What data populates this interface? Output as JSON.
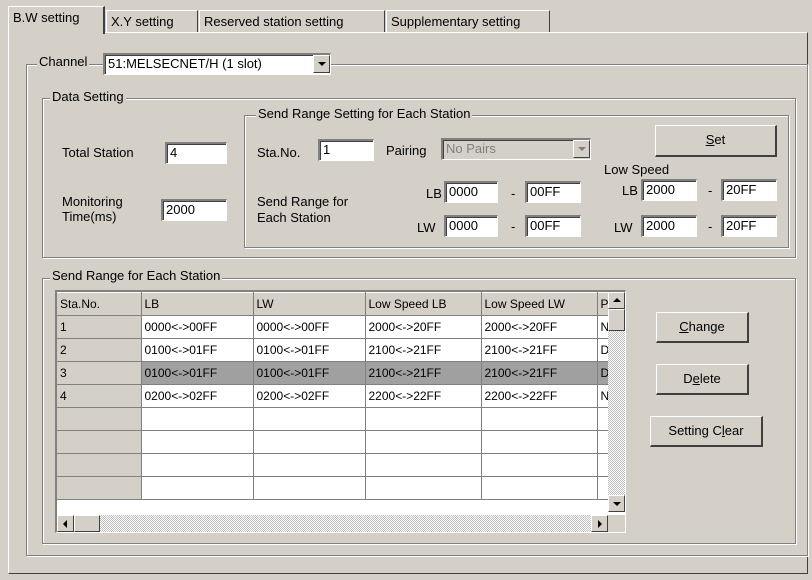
{
  "tabs": [
    {
      "label": "B.W setting",
      "active": true
    },
    {
      "label": "X.Y setting"
    },
    {
      "label": "Reserved station setting"
    },
    {
      "label": "Supplementary setting"
    }
  ],
  "channel": {
    "label": "Channel",
    "value": "51:MELSECNET/H (1 slot)"
  },
  "data_setting": {
    "title": "Data Setting",
    "total_station_label": "Total Station",
    "total_station_value": "4",
    "monitoring_label_line1": "Monitoring",
    "monitoring_label_line2": "Time(ms)",
    "monitoring_value": "2000"
  },
  "send_range_setting": {
    "title": "Send Range Setting for Each Station",
    "sta_no_label": "Sta.No.",
    "sta_no_value": "1",
    "pairing_label": "Pairing",
    "pairing_value": "No Pairs",
    "set_button_prefix": "",
    "set_button_mnemonic": "S",
    "set_button_suffix": "et",
    "low_speed_label": "Low Speed",
    "send_range_label_line1": "Send Range for",
    "send_range_label_line2": "Each Station",
    "lb_label": "LB",
    "lw_label": "LW",
    "dash": "-",
    "lb_start": "0000",
    "lb_end": "00FF",
    "lw_start": "0000",
    "lw_end": "00FF",
    "ls_lb_start": "2000",
    "ls_lb_end": "20FF",
    "ls_lw_start": "2000",
    "ls_lw_end": "20FF"
  },
  "station_table": {
    "title": "Send Range for Each Station",
    "headers": [
      "Sta.No.",
      "LB",
      "LW",
      "Low Speed LB",
      "Low Speed LW",
      "P"
    ],
    "rows": [
      [
        "1",
        "0000<->00FF",
        "0000<->00FF",
        "2000<->20FF",
        "2000<->20FF",
        "N"
      ],
      [
        "2",
        "0100<->01FF",
        "0100<->01FF",
        "2100<->21FF",
        "2100<->21FF",
        "D"
      ],
      [
        "3",
        "0100<->01FF",
        "0100<->01FF",
        "2100<->21FF",
        "2100<->21FF",
        "D"
      ],
      [
        "4",
        "0200<->02FF",
        "0200<->02FF",
        "2200<->22FF",
        "2200<->22FF",
        "N"
      ]
    ],
    "selected_row": 3
  },
  "buttons": {
    "change_prefix": "",
    "change_mnemonic": "C",
    "change_suffix": "hange",
    "delete_prefix": "D",
    "delete_mnemonic": "e",
    "delete_suffix": "lete",
    "clear_prefix": "Setting C",
    "clear_mnemonic": "l",
    "clear_suffix": "ear"
  },
  "colors": {
    "window_bg": "#d4d0c8",
    "selected_row": "#a0a0a0"
  }
}
